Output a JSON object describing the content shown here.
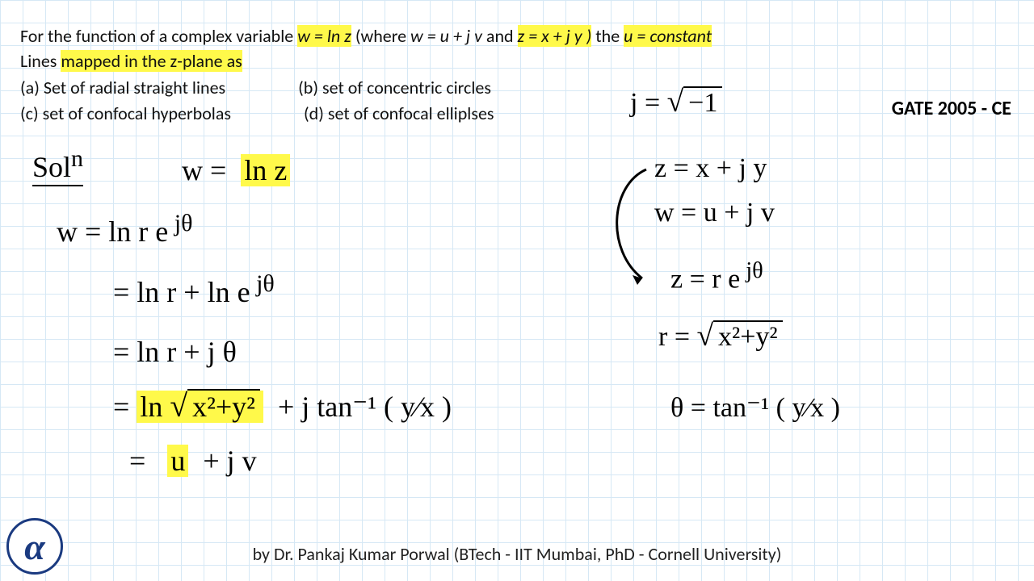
{
  "question": {
    "line1_pre": "For the function of a complex variable ",
    "line1_hl1": "w = ln z",
    "line1_mid": " (where ",
    "line1_ital1": "w  =  u + j v",
    "line1_and": " and ",
    "line1_hl2": "z  =  x + j y )",
    "line1_post": " the ",
    "line1_hl3": "u = constant",
    "line2_pre": "Lines ",
    "line2_hl": "mapped in the z-plane as",
    "opt_a": "(a)  Set of radial straight lines",
    "opt_b": "(b)  set of concentric circles",
    "opt_c": "(c)  set of confocal hyperbolas",
    "opt_d": "(d)  set of confocal elliplses",
    "exam": "GATE 2005 - CE"
  },
  "hand": {
    "soln": "Sol",
    "soln_sup": "n",
    "w_eq": "w =",
    "lnz": "ln z",
    "line2": "w =  ln  r e",
    "line2_exp": " jθ",
    "line3a": "=  ln r  +  ln e",
    "line3a_exp": " jθ",
    "line4": "=  ln r  +  j θ",
    "line5a": "=",
    "line5b": "ln ",
    "line5_rad": "x²+y²",
    "line5c": "+  j tan⁻¹ ( y⁄x )",
    "line6a": "=",
    "line6b": "u",
    "line6c": "+  j v",
    "j_def": "j =",
    "j_rad": "−1",
    "z_def": "z = x + j y",
    "w_def": "w = u + j v",
    "z_polar": "z = r e",
    "z_polar_exp": " jθ",
    "r_def": "r =",
    "r_rad": "x²+y²",
    "theta_def": "θ = tan⁻¹ ( y⁄x )"
  },
  "footer": "by Dr. Pankaj Kumar Porwal (BTech - IIT Mumbai, PhD - Cornell University)",
  "alpha": "α"
}
